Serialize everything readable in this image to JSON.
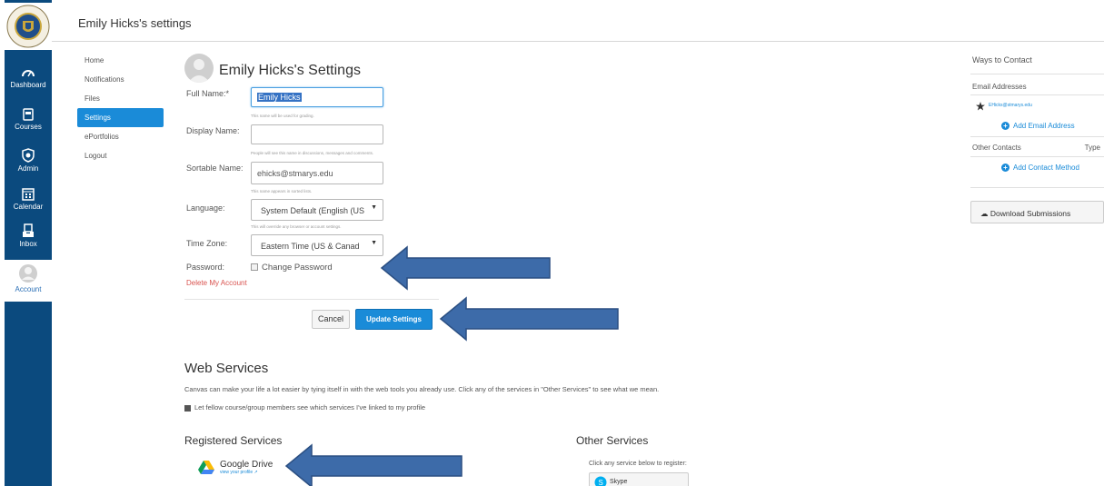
{
  "header": {
    "title": "Emily Hicks's settings"
  },
  "global_nav": {
    "items": [
      {
        "label": "Dashboard",
        "icon": "dashboard-icon"
      },
      {
        "label": "Courses",
        "icon": "courses-icon"
      },
      {
        "label": "Admin",
        "icon": "admin-icon"
      },
      {
        "label": "Calendar",
        "icon": "calendar-icon"
      },
      {
        "label": "Inbox",
        "icon": "inbox-icon"
      },
      {
        "label": "Account",
        "icon": "account-icon"
      }
    ]
  },
  "subnav": {
    "items": [
      {
        "label": "Home"
      },
      {
        "label": "Notifications"
      },
      {
        "label": "Files"
      },
      {
        "label": "Settings"
      },
      {
        "label": "ePortfolios"
      },
      {
        "label": "Logout"
      }
    ]
  },
  "form": {
    "heading": "Emily Hicks's Settings",
    "full_name": {
      "label": "Full Name:*",
      "value": "Emily Hicks",
      "hint": "This name will be used for grading."
    },
    "display_name": {
      "label": "Display Name:",
      "value": "",
      "hint": "People will see this name in discussions, messages and comments."
    },
    "sortable_name": {
      "label": "Sortable Name:",
      "value": "ehicks@stmarys.edu",
      "hint": "This name appears in sorted lists."
    },
    "language": {
      "label": "Language:",
      "value": "System Default (English (US",
      "hint": "This will override any browser or account settings."
    },
    "time_zone": {
      "label": "Time Zone:",
      "value": "Eastern Time (US & Canad"
    },
    "password": {
      "label": "Password:",
      "checkbox_label": "Change Password"
    },
    "delete_link": "Delete My Account",
    "cancel_label": "Cancel",
    "update_label": "Update Settings"
  },
  "web_services": {
    "title": "Web Services",
    "description": "Canvas can make your life a lot easier by tying itself in with the web tools you already use. Click any of the services in \"Other Services\" to see what we mean.",
    "checkbox_label": "Let fellow course/group members see which services I've linked to my profile",
    "registered_title": "Registered Services",
    "registered": [
      {
        "name": "Google Drive",
        "sub": "view your profile"
      }
    ],
    "other_title": "Other Services",
    "other_hint": "Click any service below to register:",
    "other": [
      {
        "name": "Skype"
      }
    ]
  },
  "right_panel": {
    "title": "Ways to Contact",
    "email_heading": "Email Addresses",
    "email": "EHicks@stmarys.edu",
    "add_email": "Add Email Address",
    "other_contacts": "Other Contacts",
    "type_label": "Type",
    "add_contact": "Add Contact Method",
    "download": "Download Submissions"
  },
  "colors": {
    "nav_bg": "#0b4a7e",
    "accent": "#1a8bd8",
    "arrow": "#3d6ba9",
    "danger": "#d9534f"
  }
}
